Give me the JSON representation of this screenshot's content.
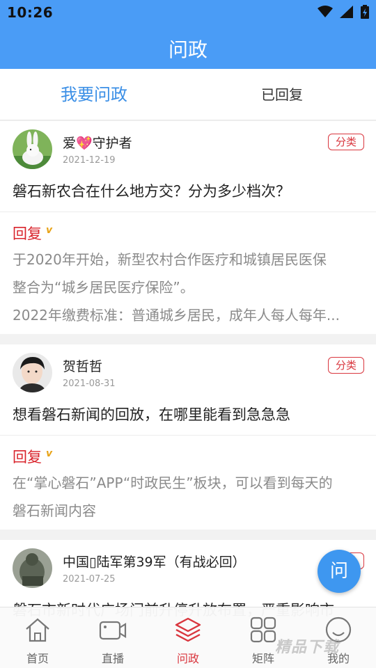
{
  "status_bar": {
    "time": "10:26"
  },
  "header": {
    "title": "问政"
  },
  "tabs": [
    {
      "label": "我要问政",
      "active": true
    },
    {
      "label": "已回复",
      "active": false
    }
  ],
  "posts": [
    {
      "user": "爱💖守护者",
      "date": "2021-12-19",
      "tag": "分类",
      "question": "磐石新农合在什么地方交？分为多少档次？",
      "reply_label": "回复",
      "reply_lines": [
        "于2020年开始，新型农村合作医疗和城镇居民医保",
        "整合为“城乡居民医疗保险”。",
        "2022年缴费标准：普通城乡居民，成年人每人每年..."
      ]
    },
    {
      "user": "贺哲哲",
      "date": "2021-08-31",
      "tag": "分类",
      "question": "想看磐石新闻的回放，在哪里能看到急急急",
      "reply_label": "回复",
      "reply_lines": [
        "在“掌心磐石”APP“时政民生”板块，可以看到每天的",
        "磐石新闻内容"
      ]
    },
    {
      "user": "中国▯陆军第39军（有战必回）",
      "date": "2021-07-25",
      "tag": "分类",
      "question": "磐石市新时代广场门前升停升放布置，严重影响市"
    }
  ],
  "fab": {
    "label": "问"
  },
  "bottom_nav": [
    {
      "label": "首页",
      "icon": "home-icon",
      "active": false
    },
    {
      "label": "直播",
      "icon": "video-camera-icon",
      "active": false
    },
    {
      "label": "问政",
      "icon": "layers-icon",
      "active": true
    },
    {
      "label": "矩阵",
      "icon": "grid-icon",
      "active": false
    },
    {
      "label": "我的",
      "icon": "smile-face-icon",
      "active": false
    }
  ],
  "watermark": "精品下载",
  "colors": {
    "primary": "#4a9cf6",
    "accent_red": "#d9363e",
    "reply_v": "#e8a317"
  }
}
